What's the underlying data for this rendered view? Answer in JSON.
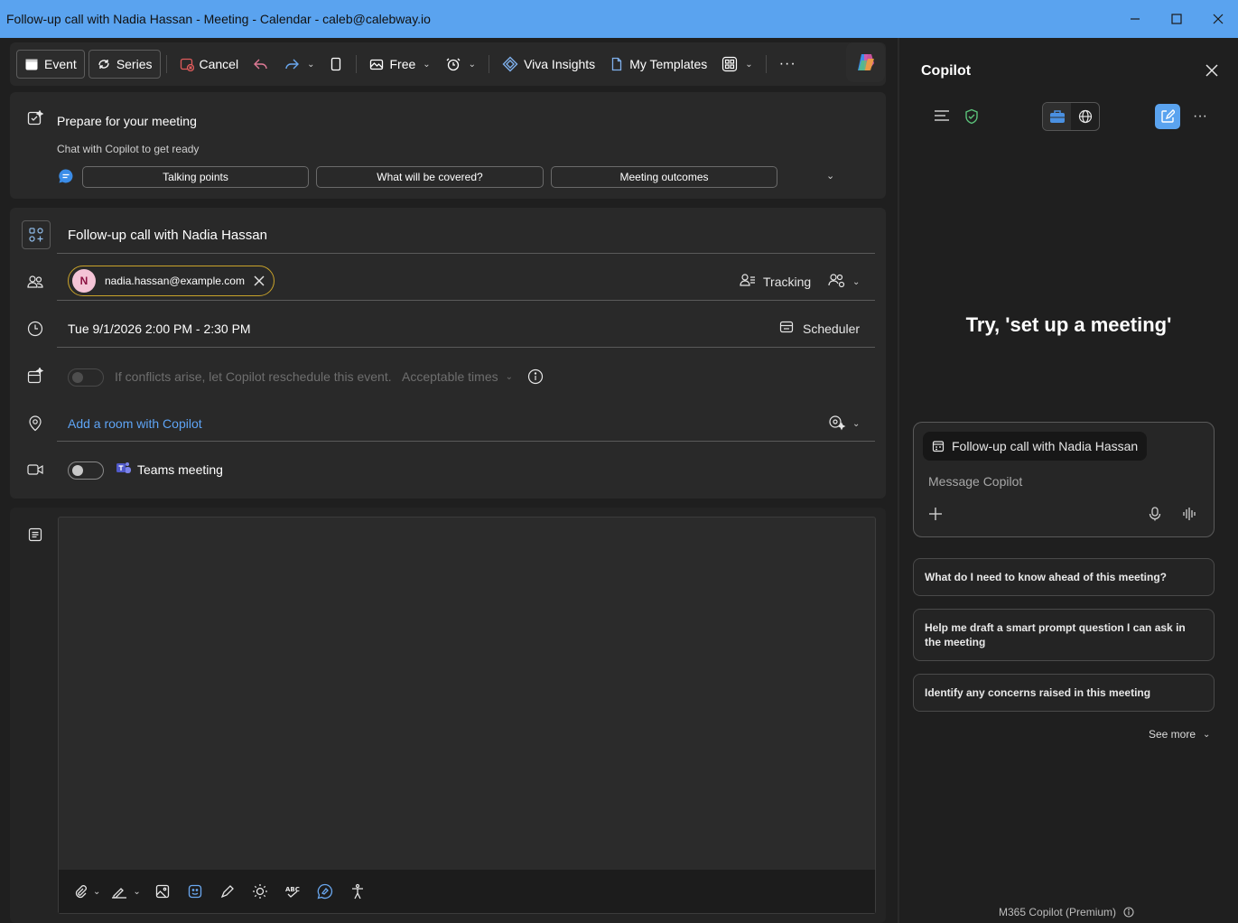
{
  "window": {
    "title": "Follow-up call with Nadia Hassan - Meeting - Calendar - caleb@calebway.io"
  },
  "toolbar": {
    "event_label": "Event",
    "series_label": "Series",
    "cancel_label": "Cancel",
    "show_as_label": "Free",
    "viva_label": "Viva Insights",
    "templates_label": "My Templates",
    "more_label": "···"
  },
  "prepare": {
    "title": "Prepare for your meeting",
    "subtitle": "Chat with Copilot to get ready",
    "buttons": [
      "Talking points",
      "What will be covered?",
      "Meeting outcomes"
    ]
  },
  "form": {
    "title": "Follow-up call with Nadia Hassan",
    "attendee": {
      "initial": "N",
      "email": "nadia.hassan@example.com"
    },
    "tracking_label": "Tracking",
    "datetime": "Tue 9/1/2026 2:00 PM - 2:30 PM",
    "scheduler_label": "Scheduler",
    "conflict_text": "If conflicts arise, let Copilot reschedule this event.",
    "acceptable_times_label": "Acceptable times",
    "add_room_label": "Add a room with Copilot",
    "teams_label": "Teams meeting",
    "teams_meeting_on": false,
    "copilot_reschedule_on": false
  },
  "copilot": {
    "title": "Copilot",
    "prompt_hint": "Try, 'set up a meeting'",
    "context_chip": "Follow-up call with Nadia Hassan",
    "message_placeholder": "Message Copilot",
    "suggestions": [
      "What do I need to know ahead of this meeting?",
      "Help me draft a smart prompt question I can ask in the meeting",
      "Identify any concerns raised in this meeting"
    ],
    "see_more_label": "See more",
    "footer_label": "M365 Copilot (Premium)"
  },
  "colors": {
    "titlebar": "#5aa3ef",
    "accent_link": "#5ea4f5",
    "attendee_border": "#c9a32a",
    "cancel_red": "#e05b5b"
  }
}
